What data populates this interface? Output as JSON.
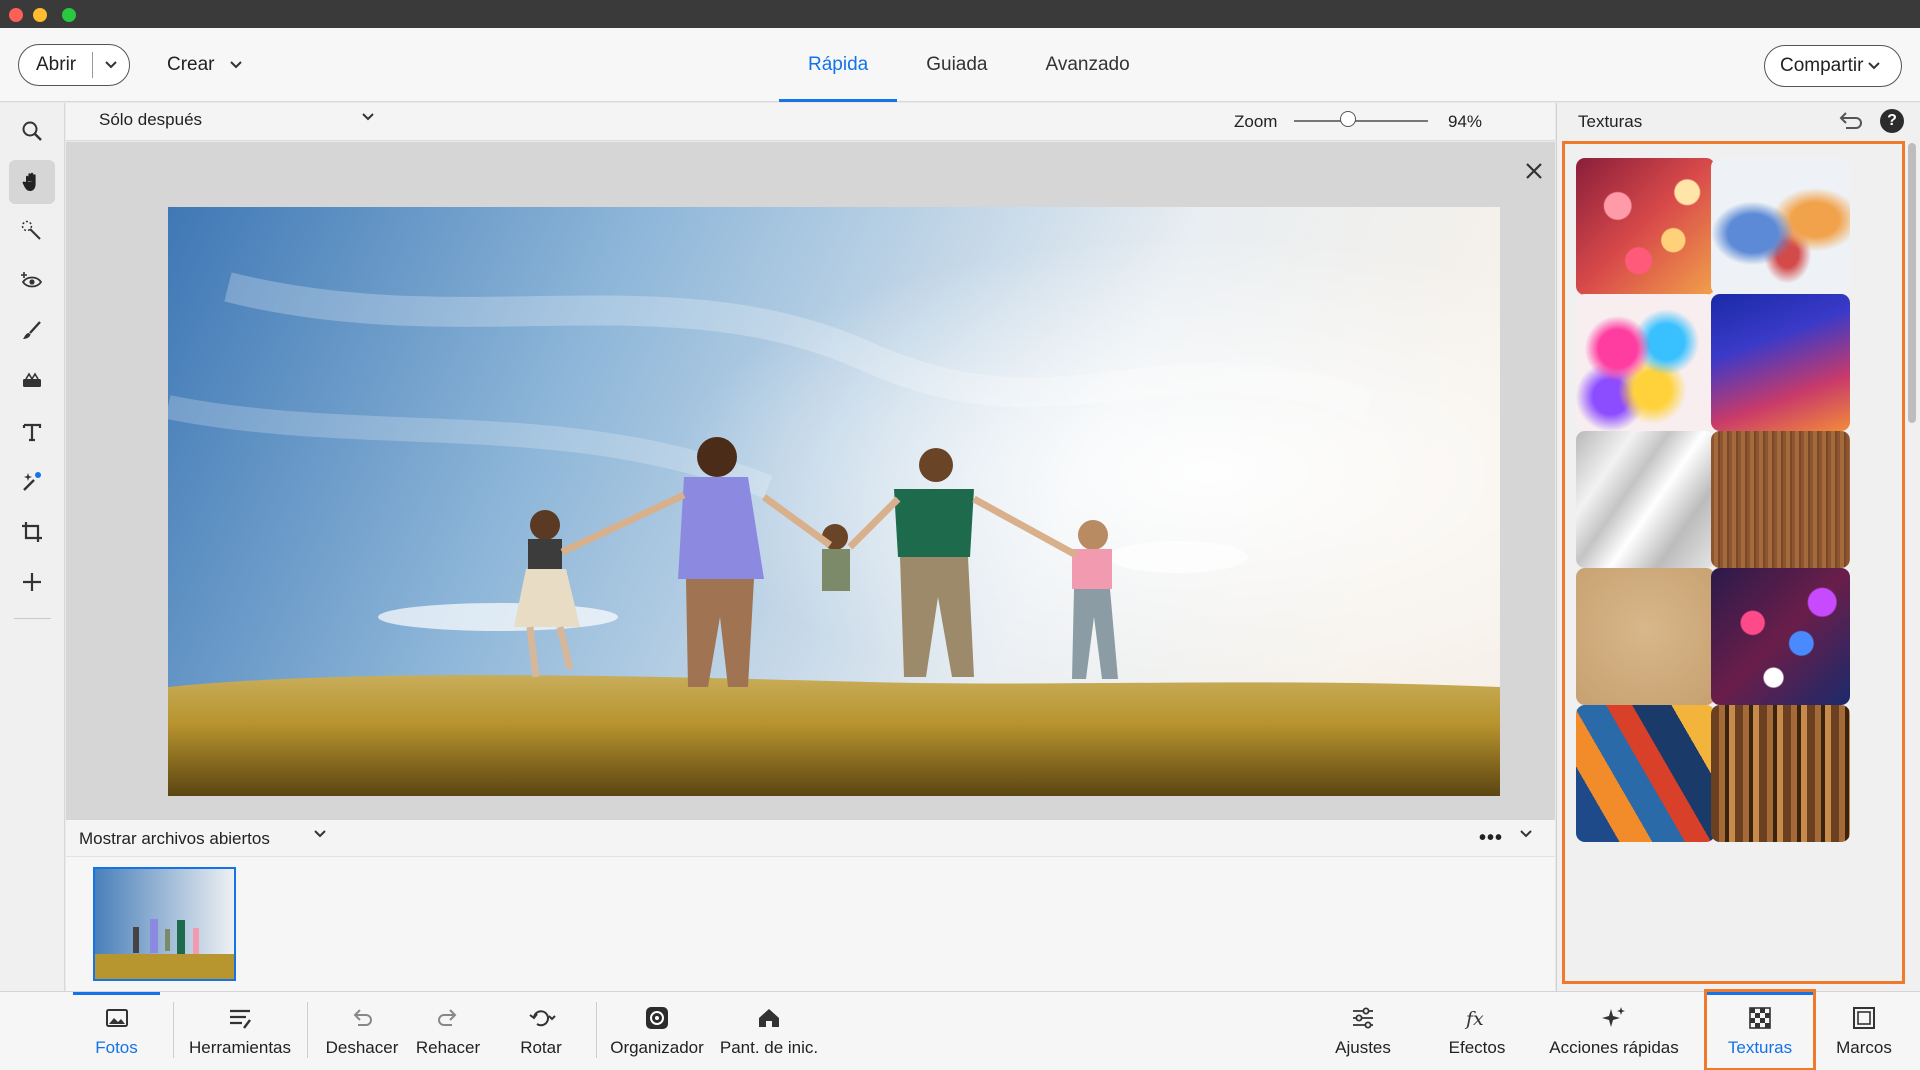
{
  "topbar": {
    "open_label": "Abrir",
    "create_label": "Crear",
    "share_label": "Compartir",
    "modes": [
      "Rápida",
      "Guiada",
      "Avanzado"
    ],
    "active_mode": "Rápida"
  },
  "options": {
    "view_label": "Sólo después",
    "zoom_label": "Zoom",
    "zoom_value": "94%",
    "zoom_fraction": 0.4
  },
  "bin": {
    "label": "Mostrar archivos abiertos",
    "more_label": "•••"
  },
  "panel": {
    "title": "Texturas",
    "help_glyph": "?",
    "textures": [
      "hearts-bokeh",
      "watercolor-smoke",
      "paint-splash",
      "blue-purple-gradient",
      "light-shadow",
      "wood-grain",
      "kraft-paper",
      "glitter-bokeh",
      "geometric-triangles",
      "wood-blocks"
    ]
  },
  "taskbar": {
    "fotos": "Fotos",
    "herramientas": "Herramientas",
    "deshacer": "Deshacer",
    "rehacer": "Rehacer",
    "rotar": "Rotar",
    "organizador": "Organizador",
    "pant_inicio": "Pant. de inic.",
    "ajustes": "Ajustes",
    "efectos": "Efectos",
    "acciones": "Acciones rápidas",
    "texturas": "Texturas",
    "marcos": "Marcos"
  },
  "colors": {
    "accent": "#1473e6",
    "highlight": "#f07a2b"
  }
}
